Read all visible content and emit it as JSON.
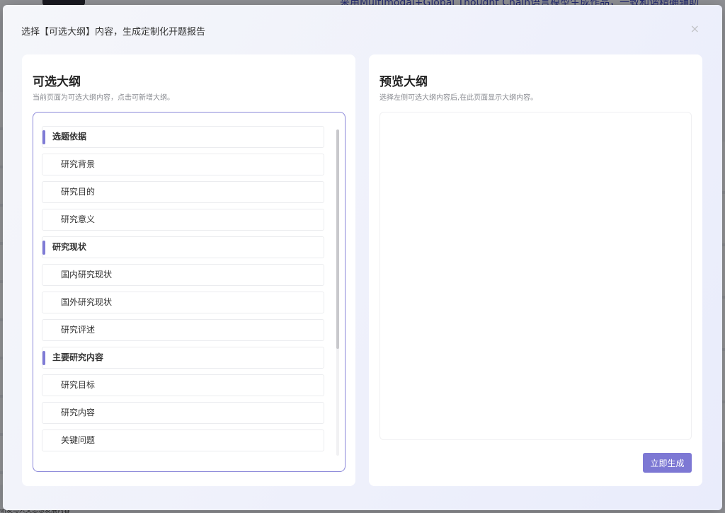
{
  "background": {
    "banner_text": "采用Multimodal+Global Thought Chain语言模型生成作品，一致和谐精确辅助",
    "footer_text": "研发与人文思想发展内容"
  },
  "modal": {
    "title": "选择【可选大纲】内容，生成定制化开题报告",
    "close_icon": "×"
  },
  "left_panel": {
    "heading": "可选大纲",
    "subtitle": "当前页面为可选大纲内容，点击可新增大纲。",
    "items": [
      {
        "type": "section",
        "label": "选题依据"
      },
      {
        "type": "sub",
        "label": "研究背景"
      },
      {
        "type": "sub",
        "label": "研究目的"
      },
      {
        "type": "sub",
        "label": "研究意义"
      },
      {
        "type": "section",
        "label": "研究现状"
      },
      {
        "type": "sub",
        "label": "国内研究现状"
      },
      {
        "type": "sub",
        "label": "国外研究现状"
      },
      {
        "type": "sub",
        "label": "研究评述"
      },
      {
        "type": "section",
        "label": "主要研究内容"
      },
      {
        "type": "sub",
        "label": "研究目标"
      },
      {
        "type": "sub",
        "label": "研究内容"
      },
      {
        "type": "sub",
        "label": "关键问题"
      }
    ]
  },
  "right_panel": {
    "heading": "预览大纲",
    "subtitle": "选择左侧可选大纲内容后,在此页面显示大纲内容。",
    "generate_label": "立即生成"
  },
  "colors": {
    "accent": "#7d78d4",
    "outline_border": "#8b88d9"
  }
}
